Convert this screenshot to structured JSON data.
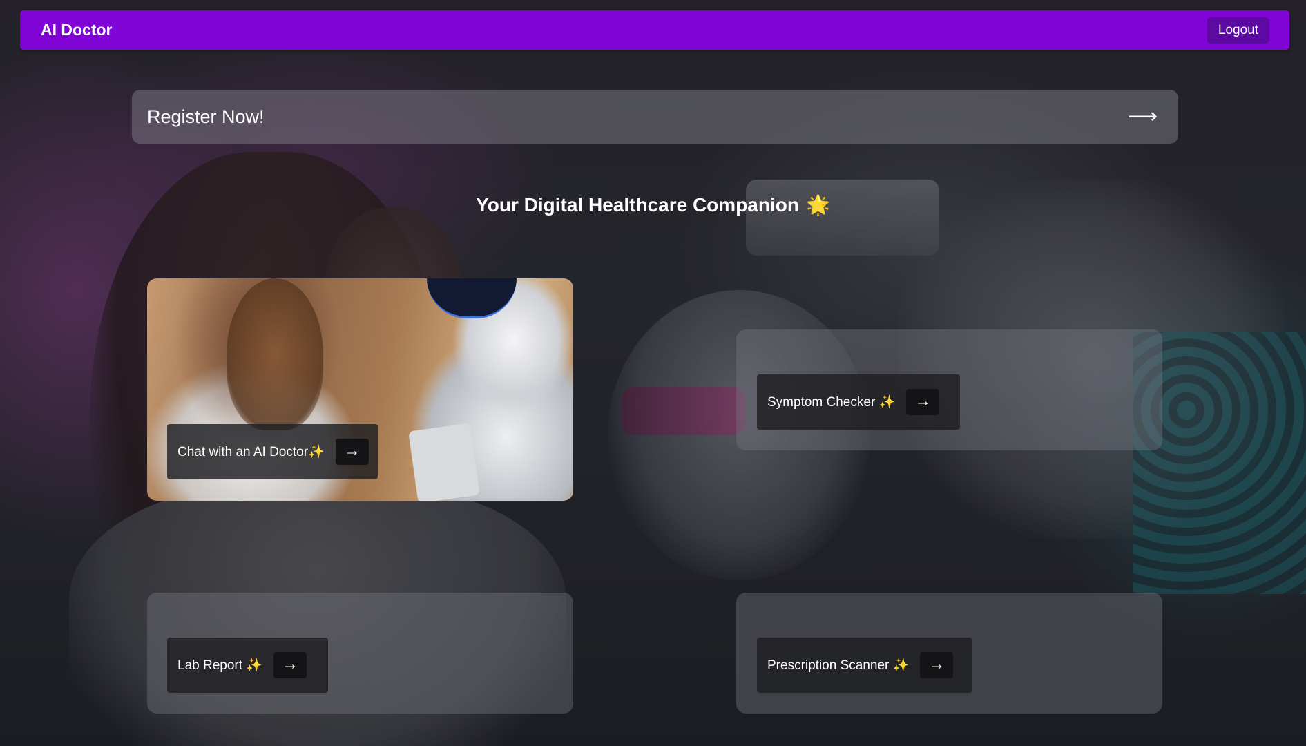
{
  "navbar": {
    "brand": "AI Doctor",
    "logout_label": "Logout"
  },
  "register": {
    "label": "Register Now!",
    "arrow": "⟶"
  },
  "heading": {
    "text": "Your Digital Healthcare Companion",
    "emoji": "🌟"
  },
  "features": [
    {
      "label": "Chat with an AI Doctor✨",
      "arrow": "→"
    },
    {
      "label": "Symptom Checker ✨",
      "arrow": "→"
    },
    {
      "label": "Lab Report ✨",
      "arrow": "→"
    },
    {
      "label": "Prescription Scanner ✨",
      "arrow": "→"
    }
  ],
  "colors": {
    "navbar": "#8004d5",
    "logout_button": "#5c0aa2",
    "card_action": "#1e1e22"
  }
}
